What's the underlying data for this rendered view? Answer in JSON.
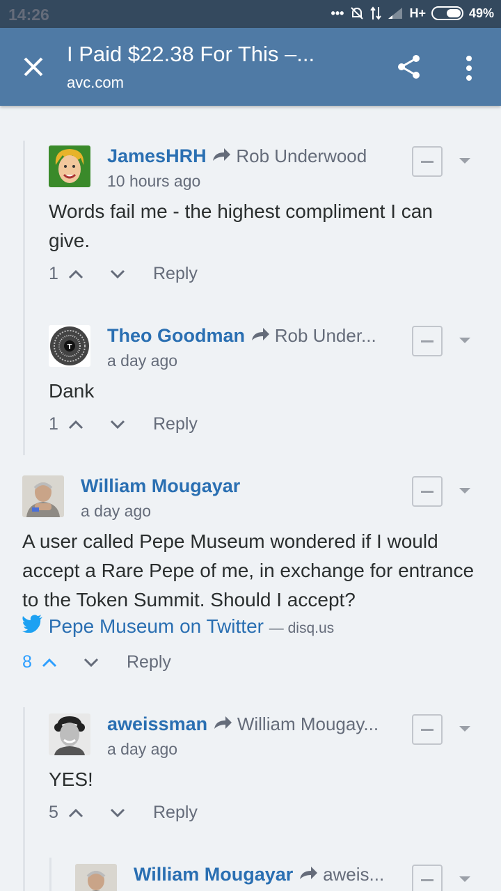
{
  "status": {
    "time": "14:26",
    "network": "H+",
    "battery": "49%"
  },
  "appbar": {
    "title": "I Paid $22.38 For This –...",
    "subtitle": "avc.com"
  },
  "comments": [
    {
      "author": "JamesHRH",
      "reply_to": "Rob Underwood",
      "time": "10 hours ago",
      "body": "Words fail me - the highest compliment I can give.",
      "votes": "1",
      "reply": "Reply"
    },
    {
      "author": "Theo Goodman",
      "reply_to": "Rob Under...",
      "time": "a day ago",
      "body": "Dank",
      "votes": "1",
      "reply": "Reply"
    },
    {
      "author": "William Mougayar",
      "time": "a day ago",
      "body": "A user called Pepe Museum wondered if I would accept a Rare Pepe of me, in exchange for entrance to the Token Summit. Should I accept?",
      "link_text": "Pepe Museum on Twitter",
      "link_domain": "— disq.us",
      "votes": "8",
      "reply": "Reply"
    },
    {
      "author": "aweissman",
      "reply_to": "William Mougay...",
      "time": "a day ago",
      "body": "YES!",
      "votes": "5",
      "reply": "Reply"
    },
    {
      "author": "William Mougayar",
      "reply_to": "aweis..."
    }
  ],
  "colors": {
    "appbar": "#4f7aa5",
    "statusbar": "#34495e",
    "author": "#2a6fb2",
    "upvoted": "#2e9fff",
    "background": "#eff2f5"
  }
}
